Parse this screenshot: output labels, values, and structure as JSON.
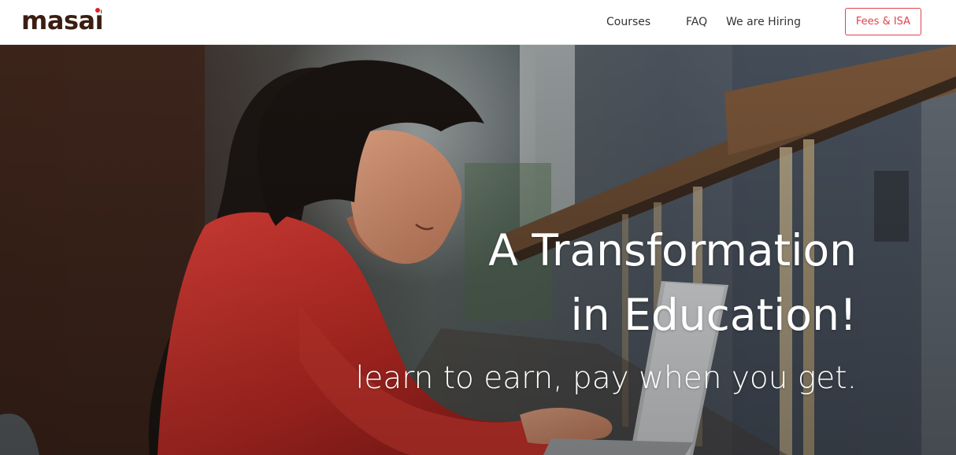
{
  "brand": {
    "logo_text": "masai",
    "logo_color": "#3b1d12",
    "accent_color": "#e21f26"
  },
  "nav": {
    "courses": "Courses",
    "faq": "FAQ",
    "hiring": "We are Hiring",
    "fees_button": "Fees & ISA",
    "fees_button_color": "#e0434b"
  },
  "hero": {
    "headline_line1": "A Transformation",
    "headline_line2": "in Education!",
    "subheadline": "learn to earn, pay when you get.",
    "image_subject": "student-in-red-hoodie-using-laptop"
  }
}
